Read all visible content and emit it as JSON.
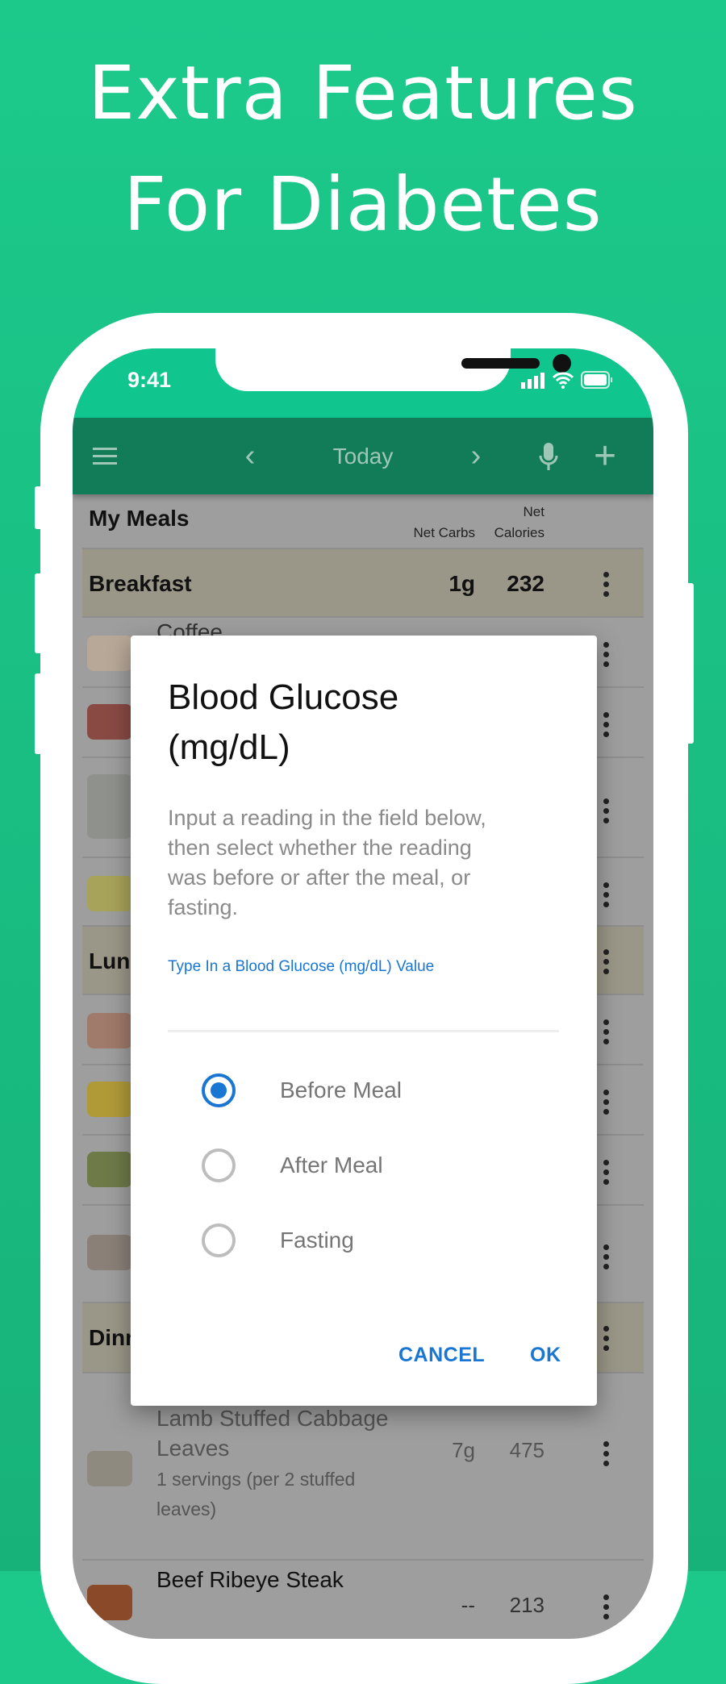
{
  "headline": {
    "line1": "Extra Features",
    "line2": "For Diabetes"
  },
  "status_bar": {
    "time": "9:41",
    "icons": [
      "signal-icon",
      "wifi-icon",
      "battery-icon"
    ]
  },
  "toolbar": {
    "menu_icon": "hamburger-icon",
    "prev": "‹",
    "title": "Today",
    "next": "›",
    "mic_icon": "microphone-icon",
    "add": "+"
  },
  "meals": {
    "title": "My Meals",
    "col_carbs": "Net Carbs",
    "col_cal_1": "Net",
    "col_cal_2": "Calories",
    "breakfast": {
      "name": "Breakfast",
      "carbs": "1g",
      "calories": "232"
    },
    "lunch": {
      "name": "Lunch"
    },
    "dinner": {
      "name": "Dinner"
    },
    "items": [
      {
        "name": "Coffee"
      },
      {
        "name": "Lamb Stuffed Cabbage",
        "name2": "Leaves",
        "serving": "1 servings (per 2 stuffed",
        "serving2": "leaves)",
        "carbs": "7g",
        "calories": "475"
      },
      {
        "name": "Beef Ribeye Steak",
        "carbs": "--",
        "calories": "213"
      }
    ]
  },
  "dialog": {
    "title1": "Blood Glucose",
    "title2": "(mg/dL)",
    "body": [
      "Input a reading in the field below,",
      "then select whether the reading",
      "was before or after the meal, or",
      "fasting."
    ],
    "input_label": "Type In a Blood Glucose (mg/dL) Value",
    "input_value": "",
    "options": [
      {
        "label": "Before Meal",
        "selected": true
      },
      {
        "label": "After Meal",
        "selected": false
      },
      {
        "label": "Fasting",
        "selected": false
      }
    ],
    "cancel": "CANCEL",
    "ok": "OK"
  },
  "colors": {
    "brand_green": "#10c68e",
    "toolbar_green": "#127c59",
    "accent_blue": "#1976d2"
  }
}
